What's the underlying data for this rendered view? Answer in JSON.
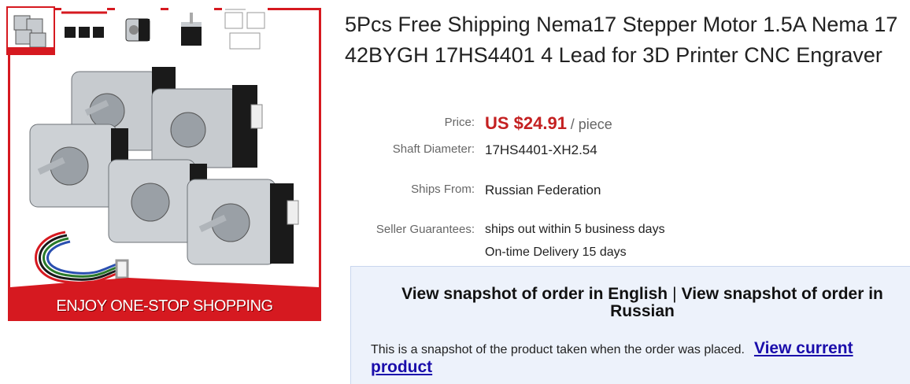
{
  "product": {
    "title": "5Pcs Free Shipping Nema17 Stepper Motor 1.5A Nema 17 42BYGH 17HS4401 4 Lead for 3D Printer CNC Engraver",
    "banner": "ENJOY ONE-STOP SHOPPING",
    "thumbnails": [
      "motors-kit-thumb",
      "motors-row-thumb",
      "motor-side-thumb",
      "motor-front-thumb",
      "spec-drawing-thumb"
    ]
  },
  "details": {
    "price_label": "Price:",
    "price_amount": "US $24.91",
    "price_unit": "/ piece",
    "shaft_label": "Shaft Diameter:",
    "shaft_value": "17HS4401-XH2.54",
    "ships_label": "Ships From:",
    "ships_value": "Russian Federation",
    "guarantee_label": "Seller Guarantees:",
    "guarantee_1": "ships out within 5 business days",
    "guarantee_2": "On-time Delivery 15 days"
  },
  "snapshot": {
    "link_english": "View snapshot of order in English",
    "separator": "|",
    "link_russian": "View snapshot of order in Russian",
    "note": "This is a snapshot of the product taken when the order was placed.",
    "view_current": "View current product"
  },
  "colors": {
    "accent": "#d61920",
    "price": "#c42021",
    "link": "#1a0dab",
    "box_bg": "#edf2fb"
  }
}
